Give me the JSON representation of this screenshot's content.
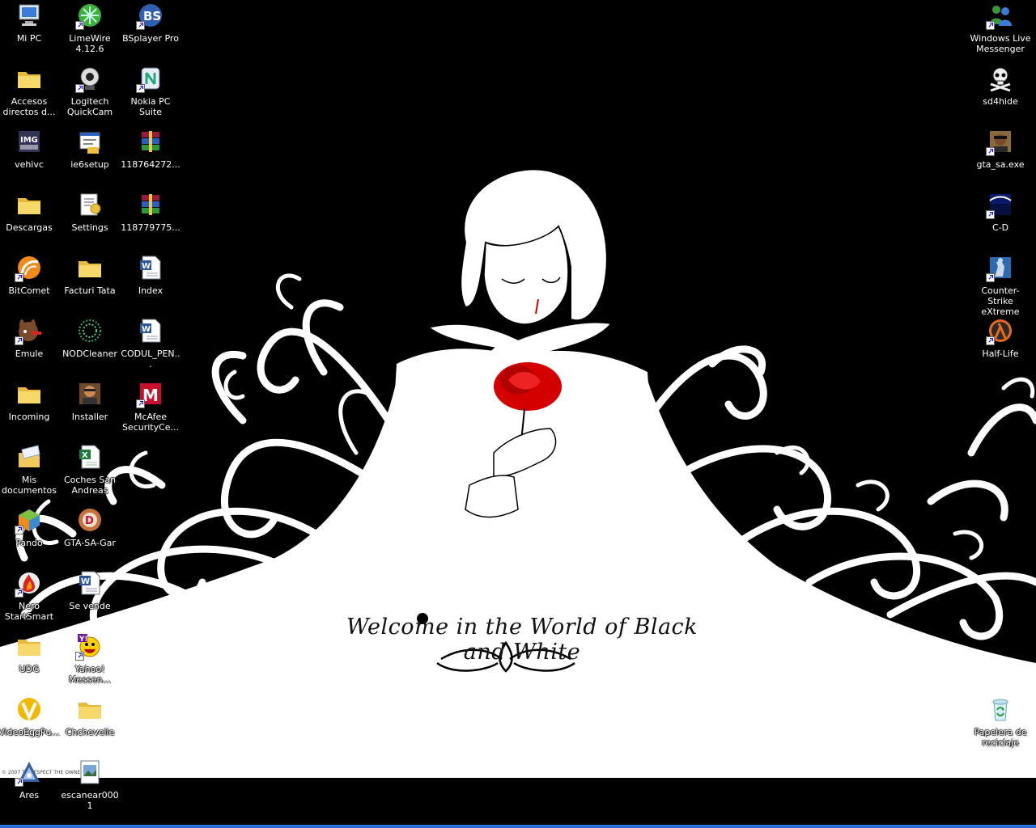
{
  "wallpaper": {
    "caption": "Welcome in the World of Black and White",
    "credit": "© 2007    TO RESPECT THE OWNER"
  },
  "desktop": {
    "icons": [
      {
        "label": "Mi PC",
        "icon": "my-computer-icon",
        "shortcut": false
      },
      {
        "label": "LimeWire 4.12.6",
        "icon": "limewire-icon",
        "shortcut": true
      },
      {
        "label": "BSplayer Pro",
        "icon": "bsplayer-icon",
        "shortcut": true
      },
      {
        "label": "Accesos directos d...",
        "icon": "folder-icon",
        "shortcut": false
      },
      {
        "label": "Logitech QuickCam",
        "icon": "webcam-icon",
        "shortcut": true
      },
      {
        "label": "Nokia PC Suite",
        "icon": "nokia-icon",
        "shortcut": true
      },
      {
        "label": "vehivc",
        "icon": "img-tool-icon",
        "shortcut": false
      },
      {
        "label": "ie6setup",
        "icon": "installer-icon",
        "shortcut": false
      },
      {
        "label": "118764272...",
        "icon": "winrar-icon",
        "shortcut": false
      },
      {
        "label": "Descargas",
        "icon": "folder-icon",
        "shortcut": false
      },
      {
        "label": "Settings",
        "icon": "settings-file-icon",
        "shortcut": false
      },
      {
        "label": "118779775...",
        "icon": "winrar-icon",
        "shortcut": false
      },
      {
        "label": "BitComet",
        "icon": "bitcomet-icon",
        "shortcut": true
      },
      {
        "label": "Facturi Tata",
        "icon": "folder-icon",
        "shortcut": false
      },
      {
        "label": "Index",
        "icon": "word-doc-icon",
        "shortcut": false
      },
      {
        "label": "Emule",
        "icon": "emule-icon",
        "shortcut": true
      },
      {
        "label": "NODCleaner",
        "icon": "nodcleaner-icon",
        "shortcut": false
      },
      {
        "label": "CODUL_PEN...",
        "icon": "word-doc-icon",
        "shortcut": false
      },
      {
        "label": "Incoming",
        "icon": "folder-icon",
        "shortcut": false
      },
      {
        "label": "Installer",
        "icon": "gta-installer-icon",
        "shortcut": false
      },
      {
        "label": "McAfee SecurityCe...",
        "icon": "mcafee-icon",
        "shortcut": true
      },
      {
        "label": "Mis documentos",
        "icon": "my-documents-icon",
        "shortcut": false
      },
      {
        "label": "Coches San Andreas",
        "icon": "excel-doc-icon",
        "shortcut": false
      },
      {
        "label": "Pando",
        "icon": "pando-icon",
        "shortcut": true
      },
      {
        "label": "GTA-SA-Gar",
        "icon": "gta-garage-icon",
        "shortcut": false
      },
      {
        "label": "Nero StartSmart",
        "icon": "nero-icon",
        "shortcut": true
      },
      {
        "label": "Se vende",
        "icon": "word-doc-icon",
        "shortcut": false
      },
      {
        "label": "UDG",
        "icon": "folder-icon",
        "shortcut": false
      },
      {
        "label": "Yahoo! Messen...",
        "icon": "yahoo-messenger-icon",
        "shortcut": true
      },
      {
        "label": "VideoEggPu...",
        "icon": "videoegg-icon",
        "shortcut": false
      },
      {
        "label": "Chchevelle",
        "icon": "folder-icon",
        "shortcut": false
      },
      {
        "label": "Ares",
        "icon": "ares-icon",
        "shortcut": true
      },
      {
        "label": "escanear0001",
        "icon": "image-file-icon",
        "shortcut": false
      },
      {
        "label": "Windows Live Messenger",
        "icon": "windows-live-messenger-icon",
        "shortcut": true
      },
      {
        "label": "sd4hide",
        "icon": "skull-icon",
        "shortcut": false
      },
      {
        "label": "gta_sa.exe",
        "icon": "gta-sa-icon",
        "shortcut": true
      },
      {
        "label": "C-D",
        "icon": "cd-app-icon",
        "shortcut": true
      },
      {
        "label": "Counter-Strike eXtreme",
        "icon": "counter-strike-icon",
        "shortcut": true
      },
      {
        "label": "Half-Life",
        "icon": "half-life-icon",
        "shortcut": true
      },
      {
        "label": "Papelera de reciclaje",
        "icon": "recycle-bin-icon",
        "shortcut": false
      }
    ]
  },
  "colors": {
    "taskbar": "#245edb",
    "rose": "#d40000",
    "folder": "#f4d35e"
  }
}
